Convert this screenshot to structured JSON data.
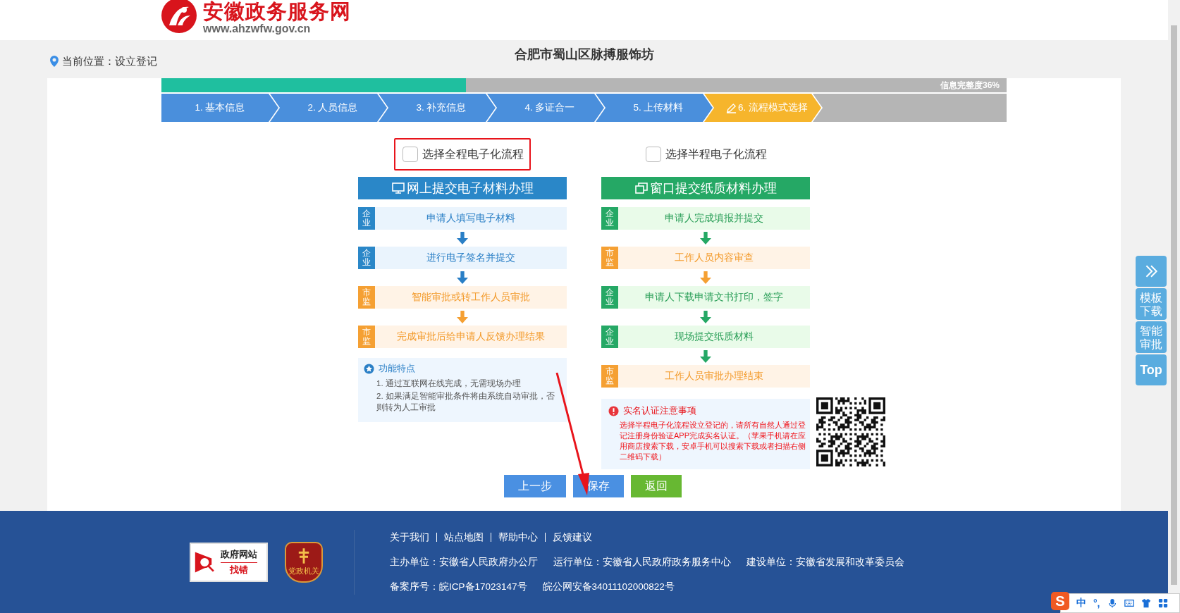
{
  "site": {
    "name": "安徽政务服务网",
    "url": "www.ahzwfw.gov.cn"
  },
  "location": "当前位置：设立登记",
  "company": "合肥市蜀山区脉搏服饰坊",
  "progress": {
    "level": 0.36,
    "label": "信息完整度36%"
  },
  "steps": [
    {
      "label": "1. 基本信息",
      "selected": false
    },
    {
      "label": "2. 人员信息",
      "selected": false
    },
    {
      "label": "3. 补充信息",
      "selected": false
    },
    {
      "label": "4. 多证合一",
      "selected": false
    },
    {
      "label": "5. 上传材料",
      "selected": false
    },
    {
      "label": "6. 流程模式选择",
      "selected": true
    }
  ],
  "options": [
    {
      "label": "选择全程电子化流程",
      "checked": false,
      "highlighted": true
    },
    {
      "label": "选择半程电子化流程",
      "checked": false,
      "highlighted": false
    }
  ],
  "flows": [
    {
      "kind": "online",
      "title": "网上提交电子材料办理",
      "steps": [
        {
          "tag": "企业",
          "kind": "enterprise",
          "text": "申请人填写电子材料"
        },
        {
          "tag": "企业",
          "kind": "enterprise",
          "text": "进行电子签名并提交"
        },
        {
          "tag": "市监",
          "kind": "regulator",
          "text": "智能审批或转工作人员审批"
        },
        {
          "tag": "市监",
          "kind": "regulator",
          "text": "完成审批后给申请人反馈办理结果"
        }
      ],
      "note": {
        "kind": "features",
        "title": "功能特点",
        "items": [
          "1. 通过互联网在线完成，无需现场办理",
          "2. 如果满足智能审批条件将由系统自动审批，否则转为人工审批"
        ]
      }
    },
    {
      "kind": "window",
      "title": "窗口提交纸质材料办理",
      "steps": [
        {
          "tag": "企业",
          "kind": "enterprise",
          "text": "申请人完成填报并提交"
        },
        {
          "tag": "市监",
          "kind": "regulator",
          "text": "工作人员内容审查"
        },
        {
          "tag": "企业",
          "kind": "enterprise",
          "text": "申请人下载申请文书打印，签字"
        },
        {
          "tag": "企业",
          "kind": "enterprise",
          "text": "现场提交纸质材料"
        },
        {
          "tag": "市监",
          "kind": "regulator",
          "text": "工作人员审批办理结束"
        }
      ],
      "note": {
        "kind": "notice",
        "title": "实名认证注意事项",
        "items": [
          "选择半程电子化流程设立登记的，请所有自然人通过登记注册身份验证APP完成实名认证。（苹果手机请在应用商店搜索下载，安卓手机可以搜索下载或者扫描右侧二维码下载）"
        ]
      }
    }
  ],
  "buttons": [
    {
      "label": "上一步",
      "kind": "primary"
    },
    {
      "label": "保存",
      "kind": "primary"
    },
    {
      "label": "返回",
      "kind": "success"
    }
  ],
  "side_tools": [
    {
      "kind": "expand"
    },
    {
      "kind": "text",
      "label": "模板下载"
    },
    {
      "kind": "text",
      "label": "智能审批"
    },
    {
      "kind": "top",
      "label": "Top"
    }
  ],
  "footer": {
    "badges": [
      {
        "kind": "error-report",
        "lines": [
          "政府网站",
          "找错"
        ]
      },
      {
        "kind": "party",
        "lines": [
          "党政机关"
        ]
      }
    ],
    "links": [
      "关于我们",
      "站点地图",
      "帮助中心",
      "反馈建议"
    ],
    "info": [
      [
        "主办单位：安徽省人民政府办公厅",
        "运行单位：安徽省人民政府政务服务中心",
        "建设单位：安徽省发展和改革委员会"
      ],
      [
        "备案序号：皖ICP备17023147号",
        "皖公网安备34011102000822号"
      ]
    ]
  },
  "ime": {
    "logo": "S",
    "mode": "中",
    "punct": "°,"
  }
}
